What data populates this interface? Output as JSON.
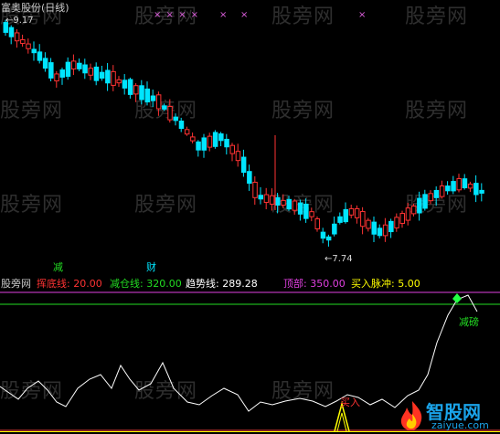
{
  "header": {
    "title": "富奥股份(日线)",
    "high_price": "9.17",
    "low_price": "7.74",
    "top_marks": [
      "× × × ×",
      "×",
      "×",
      "×"
    ]
  },
  "markers": {
    "reduce": "减",
    "wealth": "财"
  },
  "indicator": {
    "watermark_label": "股旁网",
    "lines": [
      {
        "label": "挥底线",
        "value": "20.00",
        "color": "#ff3333"
      },
      {
        "label": "减仓线",
        "value": "320.00",
        "color": "#22dd22"
      },
      {
        "label": "趋势线",
        "value": "289.28",
        "color": "#ffffff"
      },
      {
        "label": "顶部",
        "value": "350.00",
        "color": "#e040e0"
      },
      {
        "label": "买入脉冲",
        "value": "5.00",
        "color": "#ffff00"
      }
    ],
    "signal_top": "减磅",
    "signal_bottom": "买入"
  },
  "watermark": "股旁网",
  "logo": {
    "name": "智股网",
    "url": "zaiyue.com"
  },
  "colors": {
    "up": "#ff3333",
    "down": "#00e5ff",
    "trend": "#ffffff",
    "top_line": "#e040e0",
    "reduce_line": "#22dd22",
    "buy_pulse": "#ffff00"
  }
}
